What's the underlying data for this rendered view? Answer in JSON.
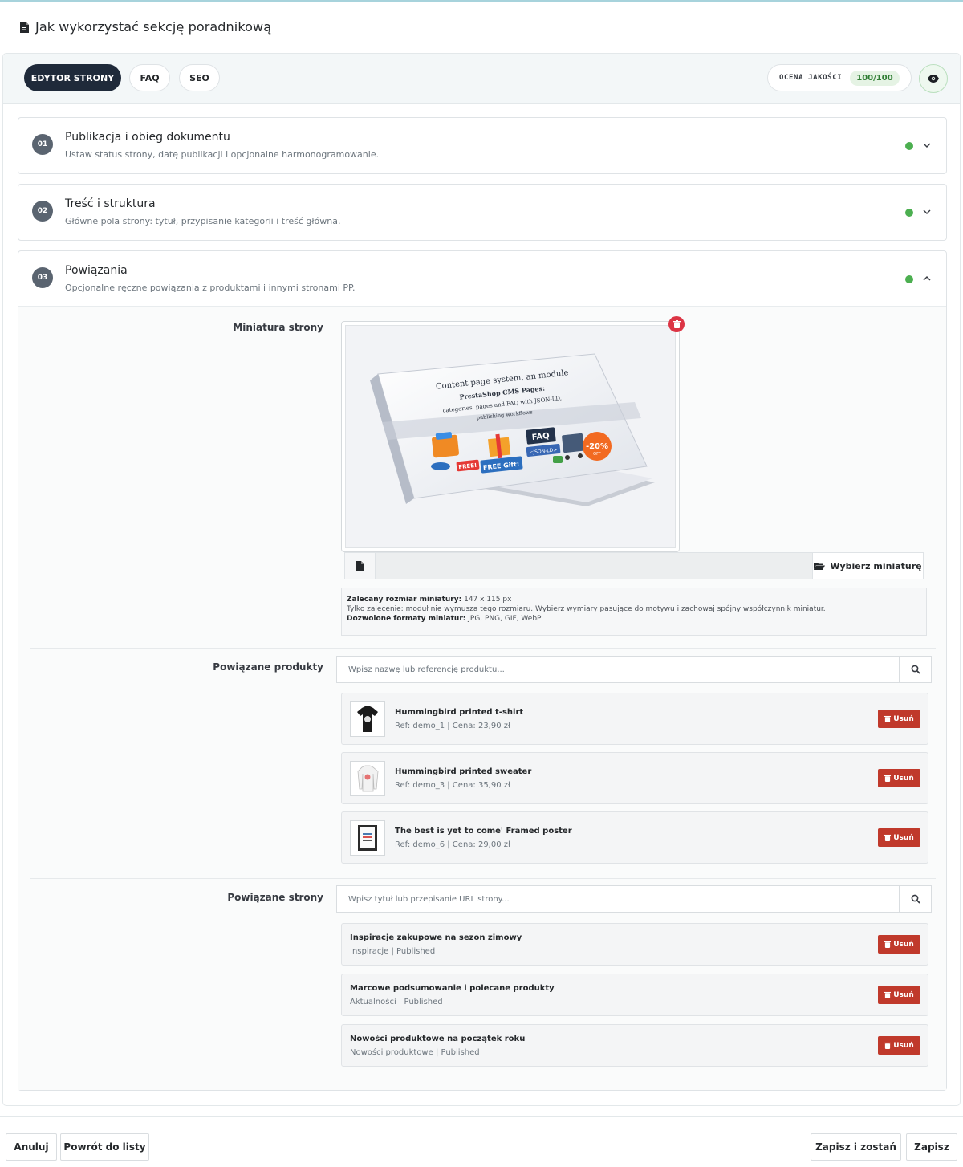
{
  "page": {
    "title": "Jak wykorzystać sekcję poradnikową"
  },
  "tabs": [
    {
      "label": "EDYTOR STRONY",
      "active": true
    },
    {
      "label": "FAQ",
      "active": false
    },
    {
      "label": "SEO",
      "active": false
    }
  ],
  "quality": {
    "label": "OCENA JAKOŚCI",
    "score": "100/100"
  },
  "sections": [
    {
      "number": "01",
      "title": "Publikacja i obieg dokumentu",
      "description": "Ustaw status strony, datę publikacji i opcjonalne harmonogramowanie.",
      "expanded": false
    },
    {
      "number": "02",
      "title": "Treść i struktura",
      "description": "Główne pola strony: tytuł, przypisanie kategorii i treść główna.",
      "expanded": false
    },
    {
      "number": "03",
      "title": "Powiązania",
      "description": "Opcjonalne ręczne powiązania z produktami i innymi stronami PP.",
      "expanded": true
    }
  ],
  "thumbnail": {
    "label": "Miniatura strony",
    "image_text": [
      "Content page system, an module",
      "PrestaShop CMS Pages:",
      "categories, pages and FAQ with JSON-LD,",
      "publishing workflows"
    ],
    "badges": {
      "faq": "FAQ",
      "jsonld": "<JSON-LD>",
      "free_gift": "FREE Gift!",
      "free": "FREE!",
      "discount": "-20%",
      "off": "OFF"
    },
    "choose_label": "Wybierz miniaturę",
    "hint_size_label": "Zalecany rozmiar miniatury:",
    "hint_size_value": "147 x 115 px",
    "hint_note": "Tylko zalecenie: moduł nie wymusza tego rozmiaru. Wybierz wymiary pasujące do motywu i zachowaj spójny współczynnik miniatur.",
    "hint_formats_label": "Dozwolone formaty miniatur:",
    "hint_formats_value": "JPG, PNG, GIF, WebP"
  },
  "related_products": {
    "label": "Powiązane produkty",
    "placeholder": "Wpisz nazwę lub referencję produktu...",
    "items": [
      {
        "name": "Hummingbird printed t-shirt",
        "meta": "Ref: demo_1 | Cena: 23,90 zł",
        "remove": "Usuń"
      },
      {
        "name": "Hummingbird printed sweater",
        "meta": "Ref: demo_3 | Cena: 35,90 zł",
        "remove": "Usuń"
      },
      {
        "name": "The best is yet to come' Framed poster",
        "meta": "Ref: demo_6 | Cena: 29,00 zł",
        "remove": "Usuń"
      }
    ]
  },
  "related_pages": {
    "label": "Powiązane strony",
    "placeholder": "Wpisz tytuł lub przepisanie URL strony...",
    "items": [
      {
        "name": "Inspiracje zakupowe na sezon zimowy",
        "meta": "Inspiracje | Published",
        "remove": "Usuń"
      },
      {
        "name": "Marcowe podsumowanie i polecane produkty",
        "meta": "Aktualności | Published",
        "remove": "Usuń"
      },
      {
        "name": "Nowości produktowe na początek roku",
        "meta": "Nowości produktowe | Published",
        "remove": "Usuń"
      }
    ]
  },
  "footer": {
    "cancel": "Anuluj",
    "back": "Powrót do listy",
    "save_stay": "Zapisz i zostań",
    "save": "Zapisz"
  },
  "colors": {
    "accent_dark": "#1f2a3a",
    "status_ok": "#4caf50",
    "danger": "#c0392b",
    "score_bg": "#e5f3e4"
  }
}
